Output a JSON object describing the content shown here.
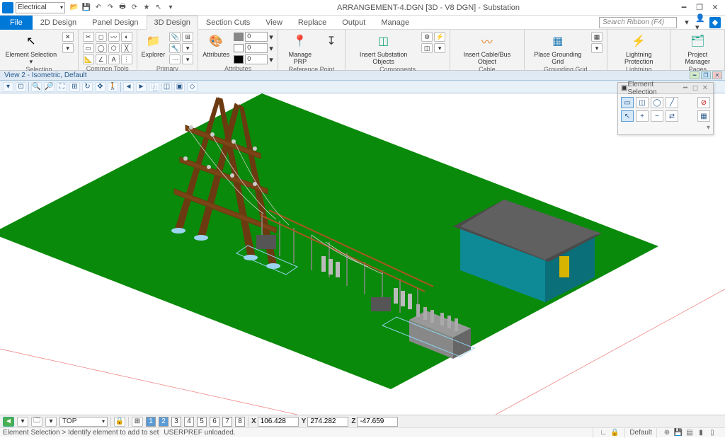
{
  "app": {
    "workflow": "Electrical",
    "title": "ARRANGEMENT-4.DGN [3D - V8 DGN] - Substation",
    "search_placeholder": "Search Ribbon (F4)"
  },
  "tabs": {
    "file": "File",
    "items": [
      "2D Design",
      "Panel Design",
      "3D Design",
      "Section Cuts",
      "View",
      "Replace",
      "Output",
      "Manage"
    ],
    "active_index": 2
  },
  "ribbon": {
    "groups": [
      {
        "label": "Selection",
        "items": [
          {
            "name": "element-selection",
            "text": "Element\nSelection ▾",
            "glyph": "↖"
          }
        ]
      },
      {
        "label": "Common Tools",
        "items": []
      },
      {
        "label": "Primary",
        "items": [
          {
            "name": "explorer",
            "text": "Explorer",
            "glyph": "📁"
          },
          {
            "name": "attach-tools",
            "text": "",
            "glyph": ""
          }
        ]
      },
      {
        "label": "Attributes",
        "items": [
          {
            "name": "attributes",
            "text": "Attributes",
            "glyph": "🎨"
          }
        ],
        "combos": [
          {
            "value": "0"
          },
          {
            "value": "0"
          },
          {
            "value": "0"
          }
        ]
      },
      {
        "label": "Reference Point",
        "items": [
          {
            "name": "manage-prp",
            "text": "Manage\nPRP",
            "glyph": "📍"
          },
          {
            "name": "ref-point",
            "text": "",
            "glyph": "↧"
          }
        ]
      },
      {
        "label": "Components",
        "items": [
          {
            "name": "insert-substation",
            "text": "Insert\nSubstation Objects",
            "glyph": "◫"
          },
          {
            "name": "comp-tools",
            "text": "",
            "glyph": "⚙"
          }
        ]
      },
      {
        "label": "Cable",
        "items": [
          {
            "name": "insert-cable",
            "text": "Insert\nCable/Bus Object",
            "glyph": "〰"
          }
        ]
      },
      {
        "label": "Grounding Grid",
        "items": [
          {
            "name": "place-grid",
            "text": "Place\nGrounding Grid",
            "glyph": "▦"
          },
          {
            "name": "grid-tools",
            "text": "",
            "glyph": "▾"
          }
        ]
      },
      {
        "label": "Lightning Protection",
        "items": [
          {
            "name": "lightning",
            "text": "Lightning\nProtection",
            "glyph": "⚡"
          }
        ]
      },
      {
        "label": "Pages",
        "items": [
          {
            "name": "project-manager",
            "text": "Project\nManager",
            "glyph": "🗂"
          }
        ]
      }
    ]
  },
  "view": {
    "label": "View 2 - Isometric, Default"
  },
  "float_window": {
    "title": "Element Selection"
  },
  "bottom": {
    "acs": "TOP",
    "view_numbers": [
      "1",
      "2",
      "3",
      "4",
      "5",
      "6",
      "7",
      "8"
    ],
    "active_view": 1,
    "coords": {
      "x_label": "X",
      "x": "106.428",
      "y_label": "Y",
      "y": "274.282",
      "z_label": "Z",
      "z": "-47.659"
    }
  },
  "status": {
    "prompt": "Element Selection > Identify element to add to set",
    "message": "USERPREF unloaded.",
    "level": "Default"
  }
}
